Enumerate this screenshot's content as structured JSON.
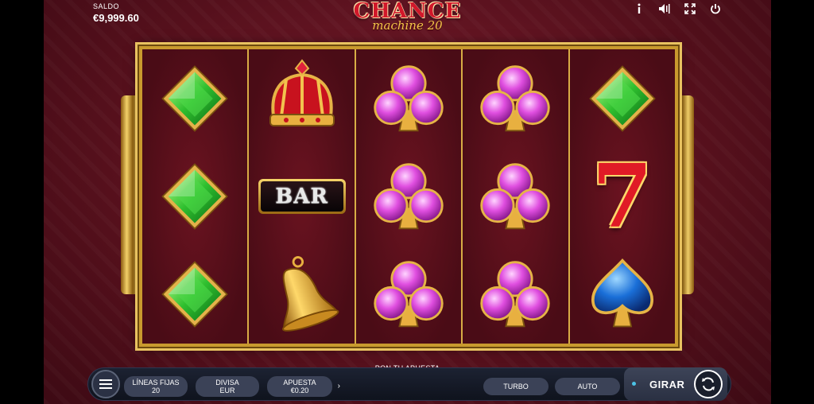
{
  "balance": {
    "label": "SALDO",
    "value": "€9,999.60"
  },
  "logo": {
    "main": "CHANCE",
    "sub": "machine 20"
  },
  "top_icons": [
    "info-icon",
    "sound-icon",
    "fullscreen-icon",
    "power-icon"
  ],
  "reels": [
    [
      "green-diamond",
      "green-diamond",
      "green-diamond"
    ],
    [
      "crown",
      "bar",
      "bell"
    ],
    [
      "purple-club",
      "purple-club",
      "purple-club"
    ],
    [
      "purple-club",
      "purple-club",
      "purple-club"
    ],
    [
      "green-diamond",
      "red-seven",
      "blue-spade"
    ]
  ],
  "bar_label": "BAR",
  "seven_label": "7",
  "controls": {
    "prompt": "PON TU APUESTA",
    "lines_label": "LÍNEAS FIJAS",
    "lines_value": "20",
    "currency_label": "DIVISA",
    "currency_value": "EUR",
    "bet_label": "APUESTA",
    "bet_value": "€0.20",
    "turbo_label": "TURBO",
    "auto_label": "AUTO",
    "spin_label": "GIRAR"
  },
  "colors": {
    "frame_gold": "#c99a2e",
    "background": "#55101c",
    "control_bar": "#1c2232"
  }
}
